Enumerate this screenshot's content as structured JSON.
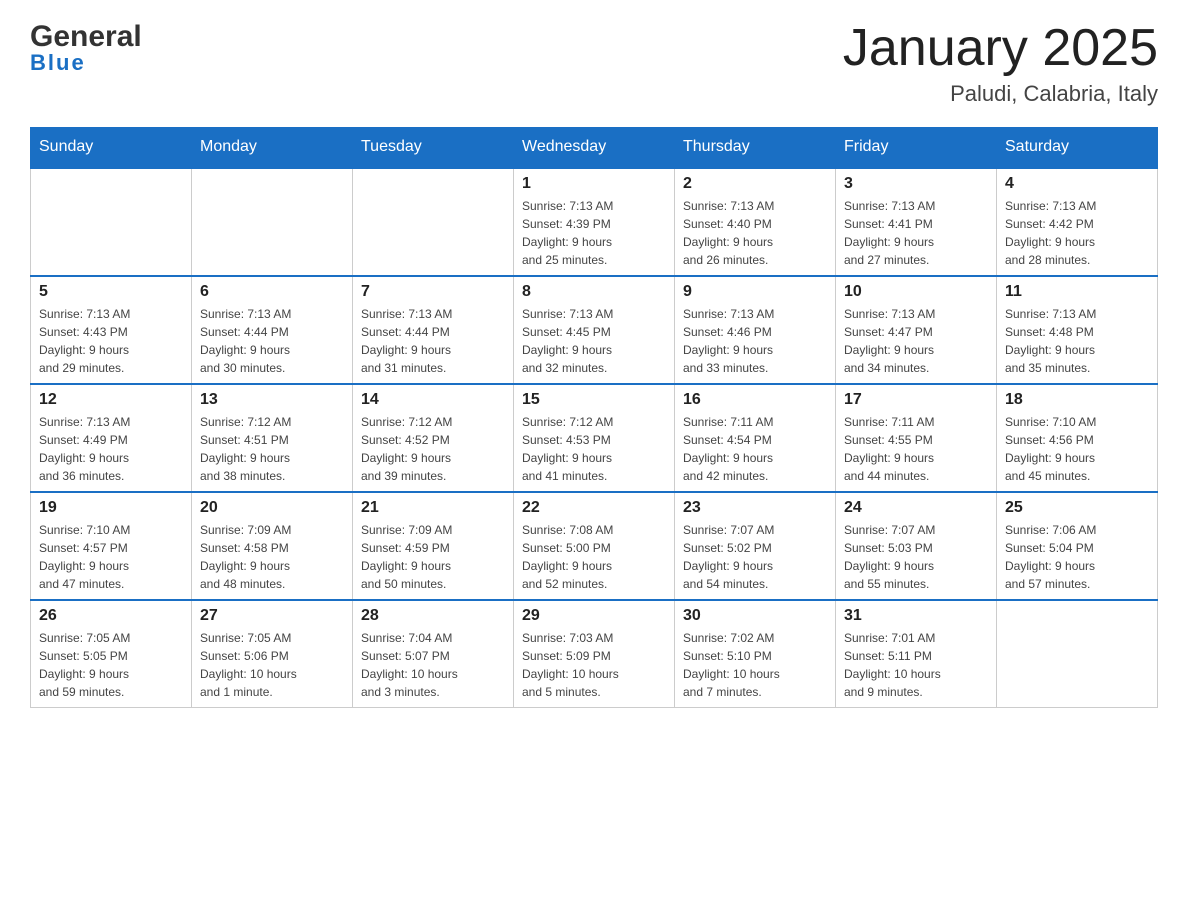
{
  "header": {
    "logo_general": "General",
    "logo_blue": "Blue",
    "month_title": "January 2025",
    "location": "Paludi, Calabria, Italy"
  },
  "days_of_week": [
    "Sunday",
    "Monday",
    "Tuesday",
    "Wednesday",
    "Thursday",
    "Friday",
    "Saturday"
  ],
  "weeks": [
    [
      {
        "day": "",
        "info": ""
      },
      {
        "day": "",
        "info": ""
      },
      {
        "day": "",
        "info": ""
      },
      {
        "day": "1",
        "info": "Sunrise: 7:13 AM\nSunset: 4:39 PM\nDaylight: 9 hours\nand 25 minutes."
      },
      {
        "day": "2",
        "info": "Sunrise: 7:13 AM\nSunset: 4:40 PM\nDaylight: 9 hours\nand 26 minutes."
      },
      {
        "day": "3",
        "info": "Sunrise: 7:13 AM\nSunset: 4:41 PM\nDaylight: 9 hours\nand 27 minutes."
      },
      {
        "day": "4",
        "info": "Sunrise: 7:13 AM\nSunset: 4:42 PM\nDaylight: 9 hours\nand 28 minutes."
      }
    ],
    [
      {
        "day": "5",
        "info": "Sunrise: 7:13 AM\nSunset: 4:43 PM\nDaylight: 9 hours\nand 29 minutes."
      },
      {
        "day": "6",
        "info": "Sunrise: 7:13 AM\nSunset: 4:44 PM\nDaylight: 9 hours\nand 30 minutes."
      },
      {
        "day": "7",
        "info": "Sunrise: 7:13 AM\nSunset: 4:44 PM\nDaylight: 9 hours\nand 31 minutes."
      },
      {
        "day": "8",
        "info": "Sunrise: 7:13 AM\nSunset: 4:45 PM\nDaylight: 9 hours\nand 32 minutes."
      },
      {
        "day": "9",
        "info": "Sunrise: 7:13 AM\nSunset: 4:46 PM\nDaylight: 9 hours\nand 33 minutes."
      },
      {
        "day": "10",
        "info": "Sunrise: 7:13 AM\nSunset: 4:47 PM\nDaylight: 9 hours\nand 34 minutes."
      },
      {
        "day": "11",
        "info": "Sunrise: 7:13 AM\nSunset: 4:48 PM\nDaylight: 9 hours\nand 35 minutes."
      }
    ],
    [
      {
        "day": "12",
        "info": "Sunrise: 7:13 AM\nSunset: 4:49 PM\nDaylight: 9 hours\nand 36 minutes."
      },
      {
        "day": "13",
        "info": "Sunrise: 7:12 AM\nSunset: 4:51 PM\nDaylight: 9 hours\nand 38 minutes."
      },
      {
        "day": "14",
        "info": "Sunrise: 7:12 AM\nSunset: 4:52 PM\nDaylight: 9 hours\nand 39 minutes."
      },
      {
        "day": "15",
        "info": "Sunrise: 7:12 AM\nSunset: 4:53 PM\nDaylight: 9 hours\nand 41 minutes."
      },
      {
        "day": "16",
        "info": "Sunrise: 7:11 AM\nSunset: 4:54 PM\nDaylight: 9 hours\nand 42 minutes."
      },
      {
        "day": "17",
        "info": "Sunrise: 7:11 AM\nSunset: 4:55 PM\nDaylight: 9 hours\nand 44 minutes."
      },
      {
        "day": "18",
        "info": "Sunrise: 7:10 AM\nSunset: 4:56 PM\nDaylight: 9 hours\nand 45 minutes."
      }
    ],
    [
      {
        "day": "19",
        "info": "Sunrise: 7:10 AM\nSunset: 4:57 PM\nDaylight: 9 hours\nand 47 minutes."
      },
      {
        "day": "20",
        "info": "Sunrise: 7:09 AM\nSunset: 4:58 PM\nDaylight: 9 hours\nand 48 minutes."
      },
      {
        "day": "21",
        "info": "Sunrise: 7:09 AM\nSunset: 4:59 PM\nDaylight: 9 hours\nand 50 minutes."
      },
      {
        "day": "22",
        "info": "Sunrise: 7:08 AM\nSunset: 5:00 PM\nDaylight: 9 hours\nand 52 minutes."
      },
      {
        "day": "23",
        "info": "Sunrise: 7:07 AM\nSunset: 5:02 PM\nDaylight: 9 hours\nand 54 minutes."
      },
      {
        "day": "24",
        "info": "Sunrise: 7:07 AM\nSunset: 5:03 PM\nDaylight: 9 hours\nand 55 minutes."
      },
      {
        "day": "25",
        "info": "Sunrise: 7:06 AM\nSunset: 5:04 PM\nDaylight: 9 hours\nand 57 minutes."
      }
    ],
    [
      {
        "day": "26",
        "info": "Sunrise: 7:05 AM\nSunset: 5:05 PM\nDaylight: 9 hours\nand 59 minutes."
      },
      {
        "day": "27",
        "info": "Sunrise: 7:05 AM\nSunset: 5:06 PM\nDaylight: 10 hours\nand 1 minute."
      },
      {
        "day": "28",
        "info": "Sunrise: 7:04 AM\nSunset: 5:07 PM\nDaylight: 10 hours\nand 3 minutes."
      },
      {
        "day": "29",
        "info": "Sunrise: 7:03 AM\nSunset: 5:09 PM\nDaylight: 10 hours\nand 5 minutes."
      },
      {
        "day": "30",
        "info": "Sunrise: 7:02 AM\nSunset: 5:10 PM\nDaylight: 10 hours\nand 7 minutes."
      },
      {
        "day": "31",
        "info": "Sunrise: 7:01 AM\nSunset: 5:11 PM\nDaylight: 10 hours\nand 9 minutes."
      },
      {
        "day": "",
        "info": ""
      }
    ]
  ]
}
